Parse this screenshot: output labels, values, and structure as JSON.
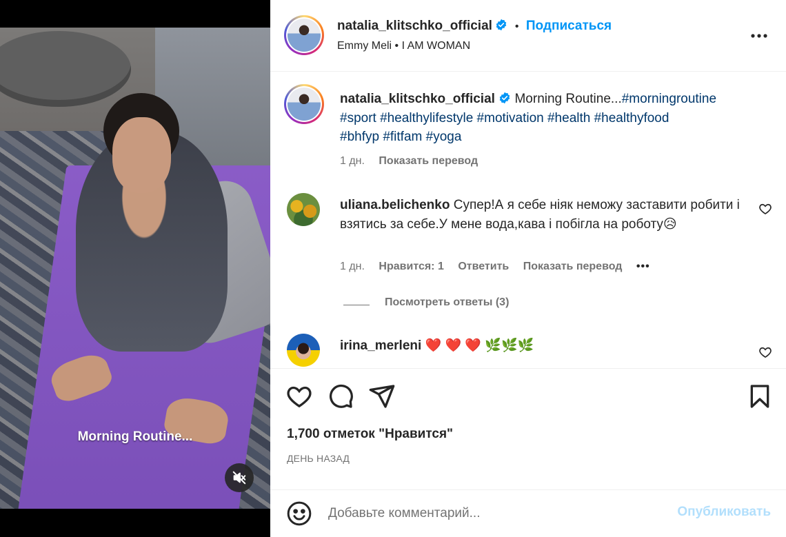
{
  "post": {
    "username": "natalia_klitschko_official",
    "follow_label": "Подписаться",
    "separator": "•",
    "audio": "Emmy Meli • I AM WOMAN",
    "video_caption": "Morning Routine..."
  },
  "caption": {
    "username": "natalia_klitschko_official",
    "text": "Morning Routine...",
    "hashtags_line1": "#morningroutine",
    "hashtags_line2": "#sport #healthylifestyle #motivation #health #healthyfood",
    "hashtags_line3": "#bhfyp #fitfam #yoga",
    "time": "1 дн.",
    "translate": "Показать перевод"
  },
  "comments": [
    {
      "username": "uliana.belichenko",
      "text": "Супер!А я себе ніяк неможу заставити робити і взятись за себе.У мене вода,кава і побігла на роботу😥",
      "time": "1 дн.",
      "likes": "Нравится: 1",
      "reply": "Ответить",
      "translate": "Показать перевод",
      "more": "•••",
      "view_replies": "Посмотреть ответы (3)"
    },
    {
      "username": "irina_merleni",
      "text": "❤️ ❤️ ❤️ 🌿🌿🌿"
    }
  ],
  "actions": {
    "likes_text": "1,700 отметок \"Нравится\"",
    "time_ago": "ДЕНЬ НАЗАД"
  },
  "comment_box": {
    "placeholder": "Добавьте комментарий...",
    "publish": "Опубликовать"
  },
  "colors": {
    "accent": "#0095f6",
    "hashtag": "#00376b",
    "muted": "#737373",
    "publish_disabled": "#b2dffc"
  },
  "icons": [
    "verified-icon",
    "more-options-icon",
    "heart-icon",
    "comment-icon",
    "share-icon",
    "bookmark-icon",
    "emoji-icon",
    "mute-icon"
  ]
}
